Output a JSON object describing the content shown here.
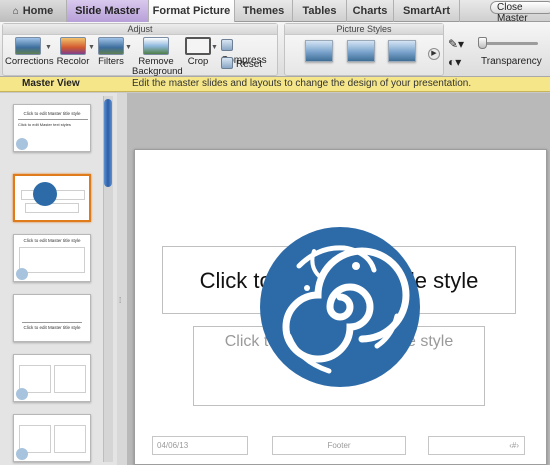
{
  "tabs": {
    "home": "Home",
    "slide_master": "Slide Master",
    "format_picture": "Format Picture",
    "themes": "Themes",
    "tables": "Tables",
    "charts": "Charts",
    "smartart": "SmartArt"
  },
  "ribbon": {
    "adjust_group": "Adjust",
    "corrections": "Corrections",
    "recolor": "Recolor",
    "filters": "Filters",
    "remove_background_1": "Remove",
    "remove_background_2": "Background",
    "crop": "Crop",
    "compress": "Compress",
    "reset": "Reset",
    "picture_styles_group": "Picture Styles",
    "transparency": "Transparency"
  },
  "master_view": {
    "title": "Master View",
    "description": "Edit the master slides and layouts to change the design of your presentation.",
    "close": "Close Master"
  },
  "thumbnails": {
    "master_title": "Click to edit Master title style",
    "master_text": "Click to edit Master text styles",
    "title_only": "Click to edit Master title style"
  },
  "slide": {
    "title_placeholder": "Click to edit Master title style",
    "subtitle_placeholder": "Click to edit Master subtitle style",
    "date": "04/06/13",
    "footer": "Footer",
    "slide_number": "‹#›"
  },
  "icons": {
    "home": "house-icon",
    "logo": "swirl-logo"
  },
  "colors": {
    "selected_thumb": "#e07b1b",
    "master_bar": "#f5e68a",
    "logo": "#2d6ba8",
    "slide_master_tab": "#c2aee0"
  }
}
